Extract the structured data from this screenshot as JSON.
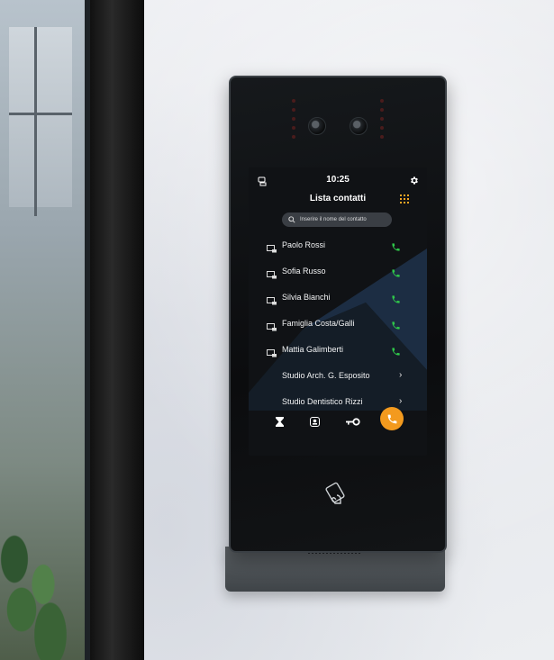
{
  "status_bar": {
    "time": "10:25",
    "left_icon": "intercom-device-icon",
    "right_icon": "gear-icon"
  },
  "header": {
    "title": "Lista contatti",
    "menu_icon": "grid-menu-icon"
  },
  "search": {
    "placeholder": "Inserire il nome del contatto",
    "icon": "search-icon"
  },
  "contacts": [
    {
      "name": "Paolo Rossi",
      "type_icon": "monitor-icon",
      "action": "call-icon"
    },
    {
      "name": "Sofia Russo",
      "type_icon": "monitor-icon",
      "action": "call-icon"
    },
    {
      "name": "Silvia Bianchi",
      "type_icon": "monitor-icon",
      "action": "call-icon"
    },
    {
      "name": "Famiglia Costa/Galli",
      "type_icon": "monitor-icon",
      "action": "call-icon"
    },
    {
      "name": "Mattia Galimberti",
      "type_icon": "monitor-icon",
      "action": "call-icon"
    },
    {
      "name": "Studio Arch. G. Esposito",
      "action": "chevron-right-icon"
    },
    {
      "name": "Studio Dentistico Rizzi",
      "action": "chevron-right-icon"
    }
  ],
  "bottom_bar": {
    "buttons": [
      "hourglass-icon",
      "face-id-icon",
      "key-icon",
      "phone-icon"
    ]
  },
  "colors": {
    "accent_orange": "#f39a1e",
    "call_green": "#2fc84a",
    "screen_bg": "#101215",
    "screen_shape": "#1e3148"
  }
}
